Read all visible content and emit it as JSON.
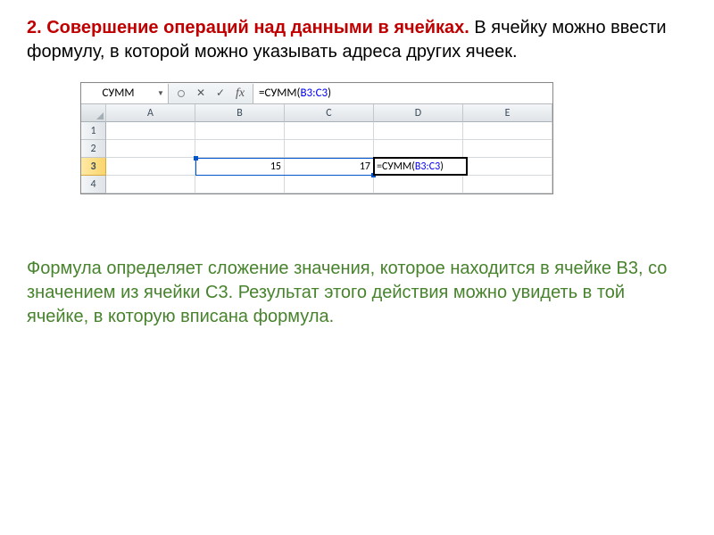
{
  "heading": {
    "title": "2. Совершение операций над данными в ячейках.",
    "rest": " В ячейку можно ввести формулу, в которой можно указывать адреса других ячеек."
  },
  "excel": {
    "name_box": "СУММ",
    "formula_prefix": "=СУММ(",
    "formula_arg": "B3:C3",
    "formula_suffix": ")",
    "columns": [
      "A",
      "B",
      "C",
      "D",
      "E"
    ],
    "rows": [
      "1",
      "2",
      "3",
      "4"
    ],
    "b3": "15",
    "c3": "17",
    "d3_display": "=СУММ(B3:C3)",
    "icons": {
      "dropdown": "▼",
      "cancel": "✕",
      "enter": "✓",
      "fx": "fx"
    }
  },
  "caption": "Формула определяет сложение значения, которое находится в ячейке В3, со значением из ячейки С3. Результат этого действия можно увидеть в той ячейке, в которую вписана формула."
}
